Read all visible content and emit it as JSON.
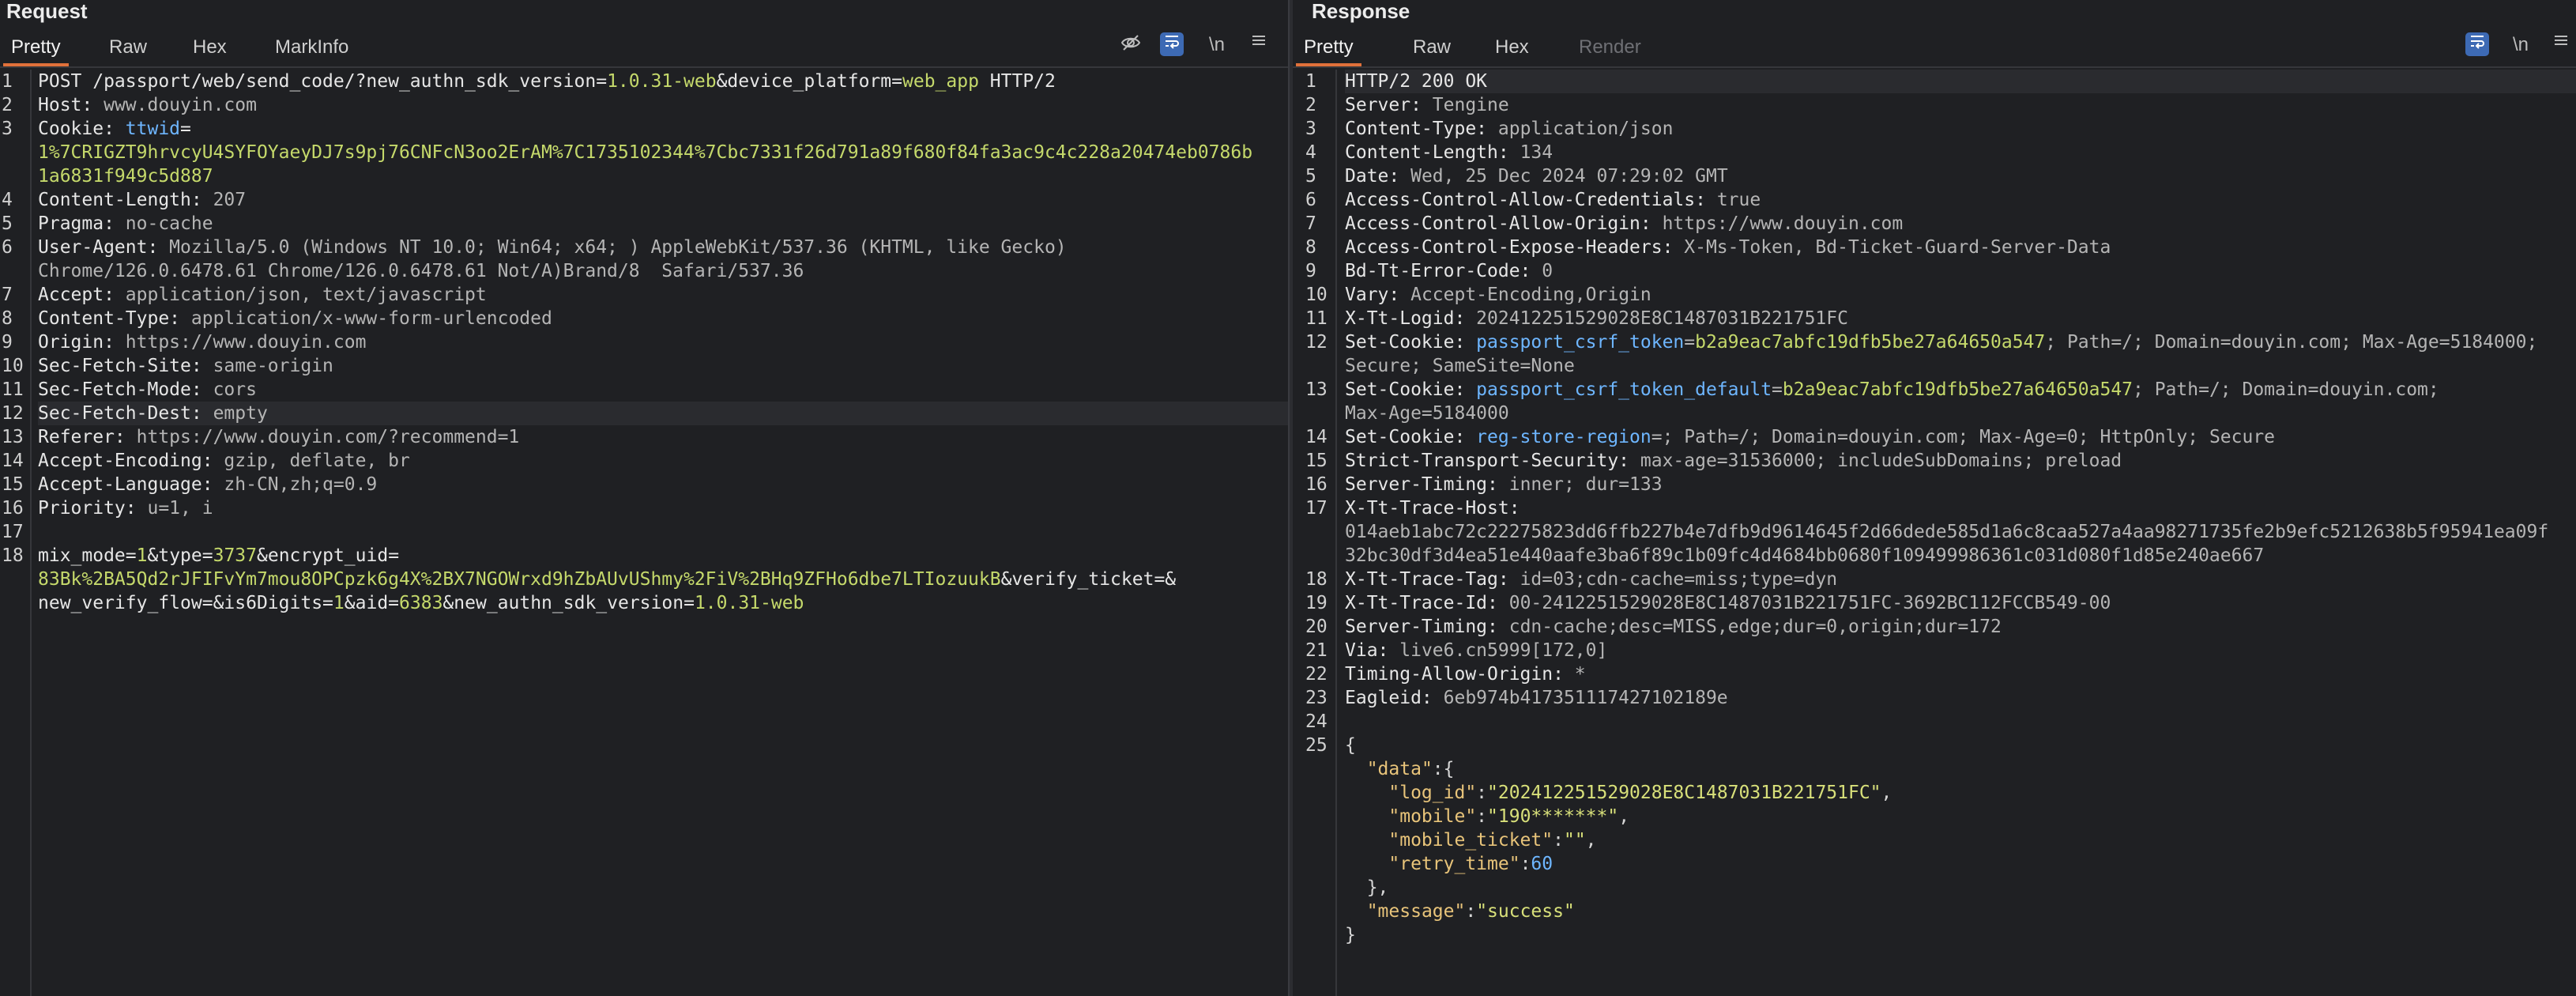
{
  "request": {
    "title": "Request",
    "tabs": [
      "Pretty",
      "Raw",
      "Hex",
      "MarkInfo"
    ],
    "active_tab": "Pretty",
    "newline_label": "\\n",
    "lines": [
      {
        "n": "1",
        "y": 0,
        "segs": [
          {
            "t": "POST /passport/web/send_code/?",
            "c": "pn"
          },
          {
            "t": "new_authn_sdk_version",
            "c": "pn"
          },
          {
            "t": "=",
            "c": "pn"
          },
          {
            "t": "1.0.31-web",
            "c": "pv"
          },
          {
            "t": "&",
            "c": "pn"
          },
          {
            "t": "device_platform",
            "c": "pn"
          },
          {
            "t": "=",
            "c": "pn"
          },
          {
            "t": "web_app",
            "c": "pv"
          },
          {
            "t": " HTTP/2",
            "c": "pn"
          }
        ]
      },
      {
        "n": "2",
        "y": 1,
        "segs": [
          {
            "t": "Host: ",
            "c": "hn"
          },
          {
            "t": "www.douyin.com",
            "c": "hv"
          }
        ]
      },
      {
        "n": "3",
        "y": 2,
        "segs": [
          {
            "t": "Cookie: ",
            "c": "hn"
          },
          {
            "t": "ttwid",
            "c": "jn"
          },
          {
            "t": "=",
            "c": "hn"
          }
        ]
      },
      {
        "n": "",
        "y": 3,
        "segs": [
          {
            "t": "1%7CRIGZT9hrvcyU4SYFOYaeyDJ7s9pj76CNFcN3oo2ErAM%7C1735102344%7Cbc7331f26d791a89f680f84fa3ac9c4c228a20474eb0786b",
            "c": "pv"
          }
        ]
      },
      {
        "n": "",
        "y": 4,
        "segs": [
          {
            "t": "1a6831f949c5d887",
            "c": "pv"
          }
        ]
      },
      {
        "n": "4",
        "y": 5,
        "segs": [
          {
            "t": "Content-Length: ",
            "c": "hn"
          },
          {
            "t": "207",
            "c": "hv"
          }
        ]
      },
      {
        "n": "5",
        "y": 6,
        "segs": [
          {
            "t": "Pragma: ",
            "c": "hn"
          },
          {
            "t": "no-cache",
            "c": "hv"
          }
        ]
      },
      {
        "n": "6",
        "y": 7,
        "segs": [
          {
            "t": "User-Agent: ",
            "c": "hn"
          },
          {
            "t": "Mozilla/5.0 (Windows NT 10.0; Win64; x64; ) AppleWebKit/537.36 (KHTML, like Gecko)",
            "c": "hv"
          }
        ]
      },
      {
        "n": "",
        "y": 8,
        "segs": [
          {
            "t": "Chrome/126.0.6478.61 Chrome/126.0.6478.61 Not/A)Brand/8  Safari/537.36",
            "c": "hv"
          }
        ]
      },
      {
        "n": "7",
        "y": 9,
        "segs": [
          {
            "t": "Accept: ",
            "c": "hn"
          },
          {
            "t": "application/json, text/javascript",
            "c": "hv"
          }
        ]
      },
      {
        "n": "8",
        "y": 10,
        "segs": [
          {
            "t": "Content-Type: ",
            "c": "hn"
          },
          {
            "t": "application/x-www-form-urlencoded",
            "c": "hv"
          }
        ]
      },
      {
        "n": "9",
        "y": 11,
        "segs": [
          {
            "t": "Origin: ",
            "c": "hn"
          },
          {
            "t": "https://www.douyin.com",
            "c": "hv"
          }
        ]
      },
      {
        "n": "10",
        "y": 12,
        "segs": [
          {
            "t": "Sec-Fetch-Site: ",
            "c": "hn"
          },
          {
            "t": "same-origin",
            "c": "hv"
          }
        ]
      },
      {
        "n": "11",
        "y": 13,
        "segs": [
          {
            "t": "Sec-Fetch-Mode: ",
            "c": "hn"
          },
          {
            "t": "cors",
            "c": "hv"
          }
        ]
      },
      {
        "n": "12",
        "y": 14,
        "hl": true,
        "segs": [
          {
            "t": "Sec-Fetch-Dest: ",
            "c": "hn"
          },
          {
            "t": "empty",
            "c": "hv"
          }
        ]
      },
      {
        "n": "13",
        "y": 15,
        "segs": [
          {
            "t": "Referer: ",
            "c": "hn"
          },
          {
            "t": "https://www.douyin.com/?recommend=1",
            "c": "hv"
          }
        ]
      },
      {
        "n": "14",
        "y": 16,
        "segs": [
          {
            "t": "Accept-Encoding: ",
            "c": "hn"
          },
          {
            "t": "gzip, deflate, br",
            "c": "hv"
          }
        ]
      },
      {
        "n": "15",
        "y": 17,
        "segs": [
          {
            "t": "Accept-Language: ",
            "c": "hn"
          },
          {
            "t": "zh-CN,zh;q=0.9",
            "c": "hv"
          }
        ]
      },
      {
        "n": "16",
        "y": 18,
        "segs": [
          {
            "t": "Priority: ",
            "c": "hn"
          },
          {
            "t": "u=1, i",
            "c": "hv"
          }
        ]
      },
      {
        "n": "17",
        "y": 19,
        "segs": []
      },
      {
        "n": "18",
        "y": 20,
        "segs": [
          {
            "t": "mix_mode",
            "c": "pn"
          },
          {
            "t": "=",
            "c": "pn"
          },
          {
            "t": "1",
            "c": "pv"
          },
          {
            "t": "&",
            "c": "pn"
          },
          {
            "t": "type",
            "c": "pn"
          },
          {
            "t": "=",
            "c": "pn"
          },
          {
            "t": "3737",
            "c": "pv"
          },
          {
            "t": "&",
            "c": "pn"
          },
          {
            "t": "encrypt_uid",
            "c": "pn"
          },
          {
            "t": "=",
            "c": "pn"
          }
        ]
      },
      {
        "n": "",
        "y": 21,
        "segs": [
          {
            "t": "83Bk%2BA5Qd2rJFIFvYm7mou8OPCpzk6g4X%2BX7NGOWrxd9hZbAUvUShmy%2FiV%2BHq9ZFHo6dbe7LTIozuukB",
            "c": "pv"
          },
          {
            "t": "&",
            "c": "pn"
          },
          {
            "t": "verify_ticket",
            "c": "pn"
          },
          {
            "t": "=&",
            "c": "pn"
          }
        ]
      },
      {
        "n": "",
        "y": 22,
        "segs": [
          {
            "t": "new_verify_flow",
            "c": "pn"
          },
          {
            "t": "=&",
            "c": "pn"
          },
          {
            "t": "is6Digits",
            "c": "pn"
          },
          {
            "t": "=",
            "c": "pn"
          },
          {
            "t": "1",
            "c": "pv"
          },
          {
            "t": "&",
            "c": "pn"
          },
          {
            "t": "aid",
            "c": "pn"
          },
          {
            "t": "=",
            "c": "pn"
          },
          {
            "t": "6383",
            "c": "pv"
          },
          {
            "t": "&",
            "c": "pn"
          },
          {
            "t": "new_authn_sdk_version",
            "c": "pn"
          },
          {
            "t": "=",
            "c": "pn"
          },
          {
            "t": "1.0.31-web",
            "c": "pv"
          }
        ]
      }
    ]
  },
  "response": {
    "title": "Response",
    "tabs": [
      "Pretty",
      "Raw",
      "Hex",
      "Render"
    ],
    "active_tab": "Pretty",
    "disabled_tab": "Render",
    "newline_label": "\\n",
    "lines": [
      {
        "n": "1",
        "y": 0,
        "hl": true,
        "segs": [
          {
            "t": "HTTP/2 200 OK",
            "c": "hn"
          }
        ]
      },
      {
        "n": "2",
        "y": 1,
        "segs": [
          {
            "t": "Server: ",
            "c": "hn"
          },
          {
            "t": "Tengine",
            "c": "hv"
          }
        ]
      },
      {
        "n": "3",
        "y": 2,
        "segs": [
          {
            "t": "Content-Type: ",
            "c": "hn"
          },
          {
            "t": "application/json",
            "c": "hv"
          }
        ]
      },
      {
        "n": "4",
        "y": 3,
        "segs": [
          {
            "t": "Content-Length: ",
            "c": "hn"
          },
          {
            "t": "134",
            "c": "hv"
          }
        ]
      },
      {
        "n": "5",
        "y": 4,
        "segs": [
          {
            "t": "Date: ",
            "c": "hn"
          },
          {
            "t": "Wed, 25 Dec 2024 07:29:02 GMT",
            "c": "hv"
          }
        ]
      },
      {
        "n": "6",
        "y": 5,
        "segs": [
          {
            "t": "Access-Control-Allow-Credentials: ",
            "c": "hn"
          },
          {
            "t": "true",
            "c": "hv"
          }
        ]
      },
      {
        "n": "7",
        "y": 6,
        "segs": [
          {
            "t": "Access-Control-Allow-Origin: ",
            "c": "hn"
          },
          {
            "t": "https://www.douyin.com",
            "c": "hv"
          }
        ]
      },
      {
        "n": "8",
        "y": 7,
        "segs": [
          {
            "t": "Access-Control-Expose-Headers: ",
            "c": "hn"
          },
          {
            "t": "X-Ms-Token, Bd-Ticket-Guard-Server-Data",
            "c": "hv"
          }
        ]
      },
      {
        "n": "9",
        "y": 8,
        "segs": [
          {
            "t": "Bd-Tt-Error-Code: ",
            "c": "hn"
          },
          {
            "t": "0",
            "c": "hv"
          }
        ]
      },
      {
        "n": "10",
        "y": 9,
        "segs": [
          {
            "t": "Vary: ",
            "c": "hn"
          },
          {
            "t": "Accept-Encoding,Origin",
            "c": "hv"
          }
        ]
      },
      {
        "n": "11",
        "y": 10,
        "segs": [
          {
            "t": "X-Tt-Logid: ",
            "c": "hn"
          },
          {
            "t": "202412251529028E8C1487031B221751FC",
            "c": "hv"
          }
        ]
      },
      {
        "n": "12",
        "y": 11,
        "segs": [
          {
            "t": "Set-Cookie: ",
            "c": "hn"
          },
          {
            "t": "passport_csrf_token",
            "c": "jn"
          },
          {
            "t": "=",
            "c": "hv"
          },
          {
            "t": "b2a9eac7abfc19dfb5be27a64650a547",
            "c": "pv"
          },
          {
            "t": "; Path=/; Domain=douyin.com; Max-Age=5184000;",
            "c": "hv"
          }
        ]
      },
      {
        "n": "",
        "y": 12,
        "segs": [
          {
            "t": "Secure; SameSite=None",
            "c": "hv"
          }
        ]
      },
      {
        "n": "13",
        "y": 13,
        "segs": [
          {
            "t": "Set-Cookie: ",
            "c": "hn"
          },
          {
            "t": "passport_csrf_token_default",
            "c": "jn"
          },
          {
            "t": "=",
            "c": "hv"
          },
          {
            "t": "b2a9eac7abfc19dfb5be27a64650a547",
            "c": "pv"
          },
          {
            "t": "; Path=/; Domain=douyin.com;",
            "c": "hv"
          }
        ]
      },
      {
        "n": "",
        "y": 14,
        "segs": [
          {
            "t": "Max-Age=5184000",
            "c": "hv"
          }
        ]
      },
      {
        "n": "14",
        "y": 15,
        "segs": [
          {
            "t": "Set-Cookie: ",
            "c": "hn"
          },
          {
            "t": "reg-store-region",
            "c": "jn"
          },
          {
            "t": "=; Path=/; Domain=douyin.com; Max-Age=0; HttpOnly; Secure",
            "c": "hv"
          }
        ]
      },
      {
        "n": "15",
        "y": 16,
        "segs": [
          {
            "t": "Strict-Transport-Security: ",
            "c": "hn"
          },
          {
            "t": "max-age=31536000; includeSubDomains; preload",
            "c": "hv"
          }
        ]
      },
      {
        "n": "16",
        "y": 17,
        "segs": [
          {
            "t": "Server-Timing: ",
            "c": "hn"
          },
          {
            "t": "inner; dur=133",
            "c": "hv"
          }
        ]
      },
      {
        "n": "17",
        "y": 18,
        "segs": [
          {
            "t": "X-Tt-Trace-Host: ",
            "c": "hn"
          }
        ]
      },
      {
        "n": "",
        "y": 19,
        "segs": [
          {
            "t": "014aeb1abc72c22275823dd6ffb227b4e7dfb9d9614645f2d66dede585d1a6c8caa527a4aa98271735fe2b9efc5212638b5f95941ea09f",
            "c": "hv"
          }
        ]
      },
      {
        "n": "",
        "y": 20,
        "segs": [
          {
            "t": "32bc30df3d4ea51e440aafe3ba6f89c1b09fc4d4684bb0680f109499986361c031d080f1d85e240ae667",
            "c": "hv"
          }
        ]
      },
      {
        "n": "18",
        "y": 21,
        "segs": [
          {
            "t": "X-Tt-Trace-Tag: ",
            "c": "hn"
          },
          {
            "t": "id=03;cdn-cache=miss;type=dyn",
            "c": "hv"
          }
        ]
      },
      {
        "n": "19",
        "y": 22,
        "segs": [
          {
            "t": "X-Tt-Trace-Id: ",
            "c": "hn"
          },
          {
            "t": "00-2412251529028E8C1487031B221751FC-3692BC112FCCB549-00",
            "c": "hv"
          }
        ]
      },
      {
        "n": "20",
        "y": 23,
        "segs": [
          {
            "t": "Server-Timing: ",
            "c": "hn"
          },
          {
            "t": "cdn-cache;desc=MISS,edge;dur=0,origin;dur=172",
            "c": "hv"
          }
        ]
      },
      {
        "n": "21",
        "y": 24,
        "segs": [
          {
            "t": "Via: ",
            "c": "hn"
          },
          {
            "t": "live6.cn5999[172,0]",
            "c": "hv"
          }
        ]
      },
      {
        "n": "22",
        "y": 25,
        "segs": [
          {
            "t": "Timing-Allow-Origin: ",
            "c": "hn"
          },
          {
            "t": "*",
            "c": "hv"
          }
        ]
      },
      {
        "n": "23",
        "y": 26,
        "segs": [
          {
            "t": "Eagleid: ",
            "c": "hn"
          },
          {
            "t": "6eb974b417351117427102189e",
            "c": "hv"
          }
        ]
      },
      {
        "n": "24",
        "y": 27,
        "segs": []
      },
      {
        "n": "25",
        "y": 28,
        "segs": [
          {
            "t": "{",
            "c": "jp"
          }
        ]
      },
      {
        "n": "",
        "y": 29,
        "segs": [
          {
            "t": "  ",
            "c": "jp"
          },
          {
            "t": "\"data\"",
            "c": "jk"
          },
          {
            "t": ":{",
            "c": "jp"
          }
        ]
      },
      {
        "n": "",
        "y": 30,
        "segs": [
          {
            "t": "    ",
            "c": "jp"
          },
          {
            "t": "\"log_id\"",
            "c": "jk"
          },
          {
            "t": ":",
            "c": "jp"
          },
          {
            "t": "\"202412251529028E8C1487031B221751FC\"",
            "c": "js"
          },
          {
            "t": ",",
            "c": "jp"
          }
        ]
      },
      {
        "n": "",
        "y": 31,
        "segs": [
          {
            "t": "    ",
            "c": "jp"
          },
          {
            "t": "\"mobile\"",
            "c": "jk"
          },
          {
            "t": ":",
            "c": "jp"
          },
          {
            "t": "\"190*******\"",
            "c": "js"
          },
          {
            "t": ",",
            "c": "jp"
          }
        ]
      },
      {
        "n": "",
        "y": 32,
        "segs": [
          {
            "t": "    ",
            "c": "jp"
          },
          {
            "t": "\"mobile_ticket\"",
            "c": "jk"
          },
          {
            "t": ":",
            "c": "jp"
          },
          {
            "t": "\"\"",
            "c": "js"
          },
          {
            "t": ",",
            "c": "jp"
          }
        ]
      },
      {
        "n": "",
        "y": 33,
        "segs": [
          {
            "t": "    ",
            "c": "jp"
          },
          {
            "t": "\"retry_time\"",
            "c": "jk"
          },
          {
            "t": ":",
            "c": "jp"
          },
          {
            "t": "60",
            "c": "jn"
          }
        ]
      },
      {
        "n": "",
        "y": 34,
        "segs": [
          {
            "t": "  },",
            "c": "jp"
          }
        ]
      },
      {
        "n": "",
        "y": 35,
        "segs": [
          {
            "t": "  ",
            "c": "jp"
          },
          {
            "t": "\"message\"",
            "c": "jk"
          },
          {
            "t": ":",
            "c": "jp"
          },
          {
            "t": "\"success\"",
            "c": "js"
          }
        ]
      },
      {
        "n": "",
        "y": 36,
        "segs": [
          {
            "t": "}",
            "c": "jp"
          }
        ]
      }
    ]
  }
}
